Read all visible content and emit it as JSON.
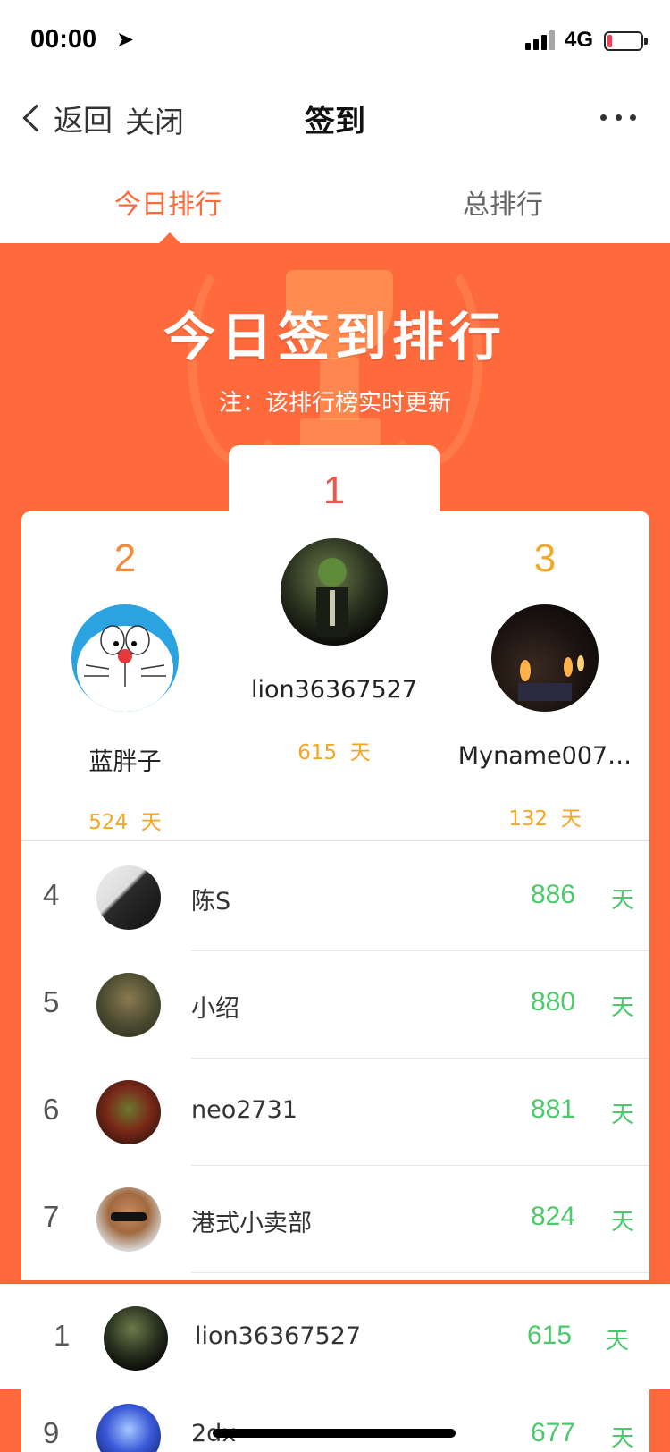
{
  "status_bar": {
    "time": "00:00",
    "network": "4G"
  },
  "nav": {
    "back_label": "返回",
    "close_label": "关闭",
    "title": "签到"
  },
  "tabs": [
    {
      "label": "今日排行",
      "active": true
    },
    {
      "label": "总排行",
      "active": false
    }
  ],
  "hero": {
    "heading": "今日签到排行",
    "note": "注：该排行榜实时更新"
  },
  "podium": [
    {
      "rank": "1",
      "name": "lion36367527",
      "days": "615",
      "unit": "天"
    },
    {
      "rank": "2",
      "name": "蓝胖子",
      "days": "524",
      "unit": "天"
    },
    {
      "rank": "3",
      "name": "Myname007…",
      "days": "132",
      "unit": "天"
    }
  ],
  "list": [
    {
      "rank": "4",
      "name": "陈S",
      "days": "886",
      "unit": "天"
    },
    {
      "rank": "5",
      "name": "小绍",
      "days": "880",
      "unit": "天"
    },
    {
      "rank": "6",
      "name": "neo2731",
      "days": "881",
      "unit": "天"
    },
    {
      "rank": "7",
      "name": "港式小卖部",
      "days": "824",
      "unit": "天"
    },
    {
      "rank": "9",
      "name": "2dx",
      "days": "677",
      "unit": "天"
    }
  ],
  "mine": {
    "rank": "1",
    "name": "lion36367527",
    "days": "615",
    "unit": "天"
  },
  "colors": {
    "brand": "#ff6a3d",
    "days_green": "#4cc96a",
    "podium_gold": "#f5a623"
  }
}
